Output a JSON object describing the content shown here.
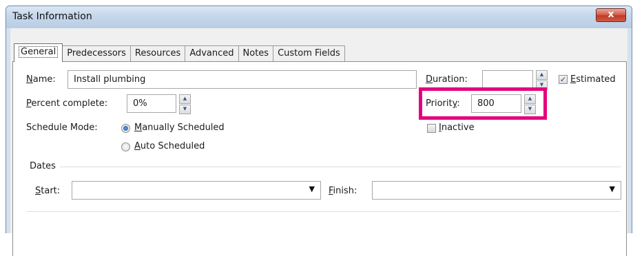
{
  "window": {
    "title": "Task Information",
    "close_label": "x"
  },
  "tabs": [
    {
      "label": "General"
    },
    {
      "label": "Predecessors"
    },
    {
      "label": "Resources"
    },
    {
      "label": "Advanced"
    },
    {
      "label": "Notes"
    },
    {
      "label": "Custom Fields"
    }
  ],
  "general": {
    "name": {
      "label_u": "N",
      "label_rest": "ame:",
      "value": "Install plumbing"
    },
    "duration": {
      "label_u": "D",
      "label_rest": "uration:",
      "value": ""
    },
    "estimated": {
      "label_u": "E",
      "label_rest": "stimated",
      "checked": true
    },
    "percent": {
      "label_u": "P",
      "label_rest": "ercent complete:",
      "value": "0%"
    },
    "priority": {
      "label_pre": "Priorit",
      "label_u": "y",
      "label_post": ":",
      "value": "800",
      "highlight_color": "#e5007d"
    },
    "schedule_mode": {
      "label": "Schedule Mode:",
      "options": [
        {
          "label_u": "M",
          "label_rest": "anually Scheduled",
          "selected": true
        },
        {
          "label_u": "A",
          "label_rest": "uto Scheduled",
          "selected": false
        }
      ]
    },
    "inactive": {
      "label_u": "I",
      "label_rest": "nactive",
      "checked": false
    },
    "dates": {
      "title": "Dates",
      "start": {
        "label_u": "S",
        "label_rest": "tart:",
        "value": ""
      },
      "finish": {
        "label_u": "F",
        "label_rest": "inish:",
        "value": ""
      }
    }
  },
  "icons": {
    "spin_up": "▲",
    "spin_down": "▼",
    "dropdown": "▼",
    "check": "✓"
  }
}
